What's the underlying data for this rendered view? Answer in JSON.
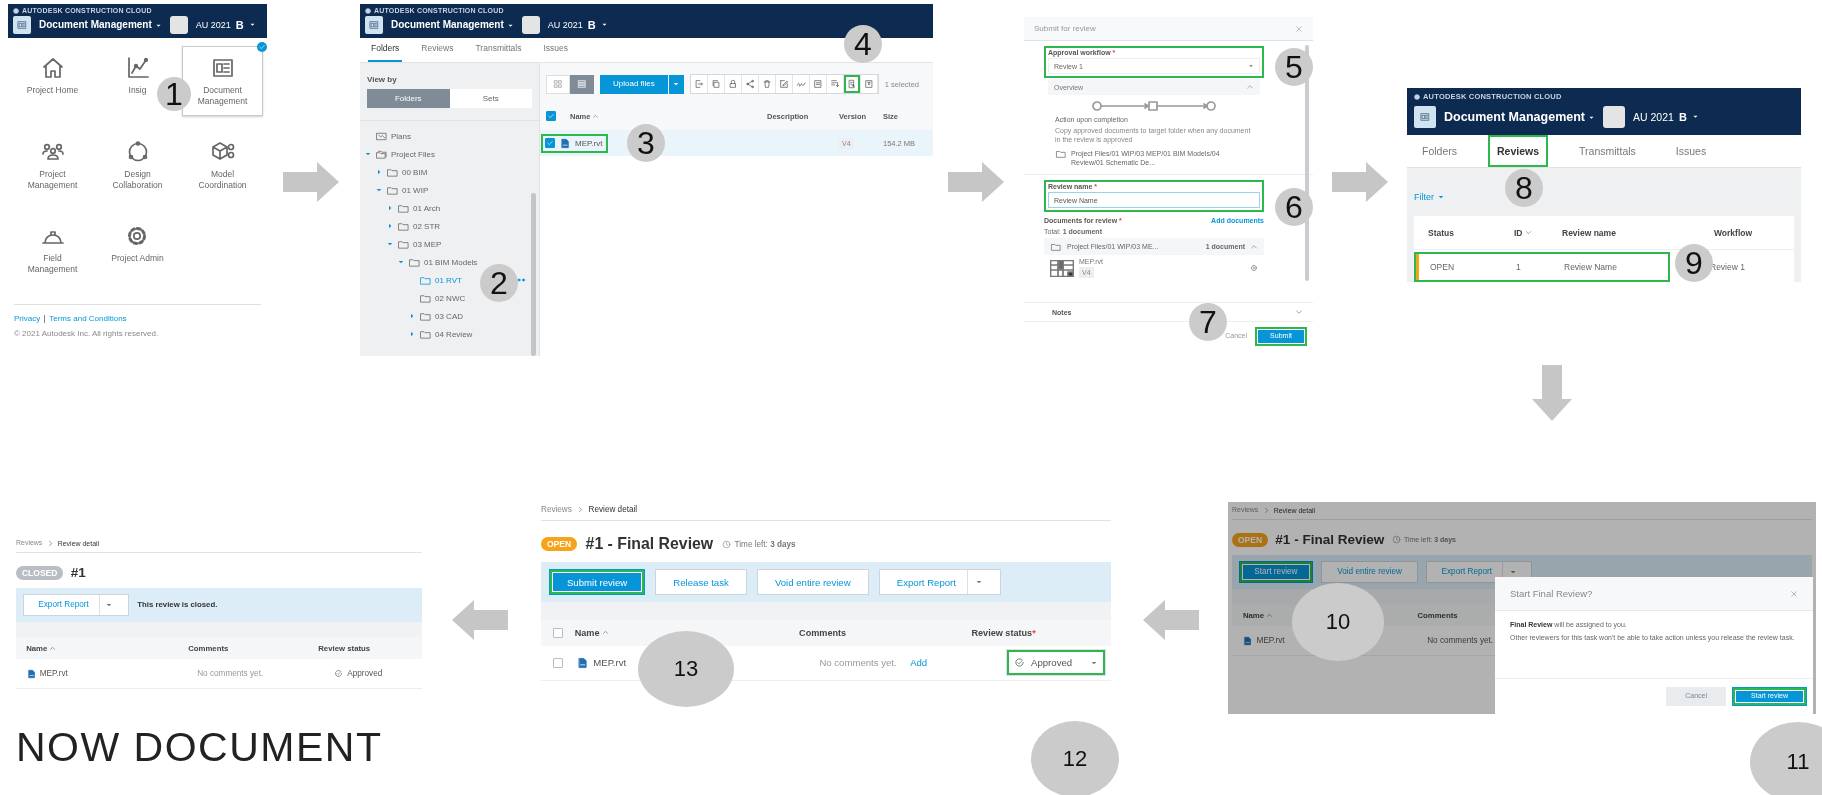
{
  "home_menu": {
    "header": {
      "brand": "AUTODESK CONSTRUCTION CLOUD",
      "module": "Document Management",
      "project": "AU 2021",
      "user": "B"
    },
    "tiles": [
      {
        "label": "Project Home",
        "kind": "home",
        "selected": false
      },
      {
        "label": "Insig",
        "kind": "chart",
        "selected": false
      },
      {
        "label": "Document Management",
        "kind": "docs",
        "selected": true
      },
      {
        "label": "Project Management",
        "kind": "people",
        "selected": false
      },
      {
        "label": "Design Collaboration",
        "kind": "circle",
        "selected": false
      },
      {
        "label": "Model Coordination",
        "kind": "cube",
        "selected": false
      },
      {
        "label": "Field Management",
        "kind": "helmet",
        "selected": false
      },
      {
        "label": "Project Admin",
        "kind": "gear",
        "selected": false
      }
    ],
    "links": [
      "Privacy",
      "Terms and Conditions"
    ],
    "copyright": "© 2021 Autodesk Inc. All rights reserved."
  },
  "files_view": {
    "header": {
      "brand": "AUTODESK CONSTRUCTION CLOUD",
      "module": "Document Management",
      "project": "AU 2021",
      "user": "B"
    },
    "tabs": [
      {
        "label": "Folders",
        "selected": true,
        "highlighted": false
      },
      {
        "label": "Reviews",
        "selected": false,
        "highlighted": false
      },
      {
        "label": "Transmittals",
        "selected": false,
        "highlighted": false
      },
      {
        "label": "Issues",
        "selected": false,
        "highlighted": false
      }
    ],
    "view_by": "View by",
    "view_toggle": [
      {
        "label": "Folders",
        "selected": true
      },
      {
        "label": "Sets",
        "selected": false
      }
    ],
    "tree": [
      {
        "label": "Plans",
        "kind": "plans",
        "selected": false
      },
      {
        "label": "Project Files",
        "kind": "project",
        "expanded": true,
        "selected": false,
        "children": [
          {
            "label": "00 BIM",
            "kind": "folder",
            "expanded": false,
            "selected": false
          },
          {
            "label": "01 WIP",
            "kind": "folder",
            "expanded": true,
            "selected": false,
            "children": [
              {
                "label": "01 Arch",
                "kind": "folder",
                "expanded": false,
                "selected": false
              },
              {
                "label": "02 STR",
                "kind": "folder",
                "expanded": false,
                "selected": false
              },
              {
                "label": "03 MEP",
                "kind": "folder",
                "expanded": true,
                "selected": false,
                "children": [
                  {
                    "label": "01 BIM Models",
                    "kind": "folder",
                    "expanded": true,
                    "selected": false,
                    "children": [
                      {
                        "label": "01 RVT",
                        "kind": "folder",
                        "selected": true
                      },
                      {
                        "label": "02 NWC",
                        "kind": "folder",
                        "selected": false
                      },
                      {
                        "label": "03 CAD",
                        "kind": "folder",
                        "expanded": false,
                        "selected": false
                      },
                      {
                        "label": "04 Review",
                        "kind": "folder",
                        "expanded": false,
                        "selected": false
                      }
                    ]
                  }
                ]
              }
            ]
          }
        ]
      }
    ],
    "layout_toggle": [
      {
        "kind": "grid",
        "selected": false
      },
      {
        "kind": "list",
        "selected": true
      }
    ],
    "upload_button": "Upload files",
    "tools": [
      {
        "kind": "export",
        "highlighted": false
      },
      {
        "kind": "copy",
        "highlighted": false
      },
      {
        "kind": "lock",
        "highlighted": false
      },
      {
        "kind": "share",
        "highlighted": false
      },
      {
        "kind": "delete",
        "highlighted": false
      },
      {
        "kind": "edit",
        "highlighted": false
      },
      {
        "kind": "sign",
        "highlighted": false
      },
      {
        "kind": "form",
        "highlighted": false
      },
      {
        "kind": "download",
        "highlighted": false
      },
      {
        "kind": "review",
        "highlighted": true
      },
      {
        "kind": "archive",
        "highlighted": false
      }
    ],
    "selection_count": "1 selected",
    "table": {
      "columns": [
        "Name",
        "Description",
        "Version",
        "Size"
      ],
      "all_checked": true,
      "rows": [
        {
          "checked": true,
          "selected": true,
          "highlighted": true,
          "name": "MEP.rvt",
          "version": "V4",
          "size": "154.2 MB"
        }
      ]
    }
  },
  "review_dialog": {
    "title": "Submit for review",
    "workflow": {
      "label": "Approval workflow",
      "required_mark": "*",
      "value": "Review 1",
      "highlighted": true
    },
    "overview": {
      "title": "Overview",
      "action_title": "Action upon completion",
      "action_text": "Copy approved documents to target folder when any document in the review is approved",
      "target_path": "Project Files/01 WIP/03 MEP/01 BIM Models/04 Review/01 Schematic De..."
    },
    "review_name": {
      "label": "Review name",
      "required_mark": "*",
      "value": "Review Name",
      "highlighted": true
    },
    "documents": {
      "label": "Documents for review",
      "required_mark": "*",
      "add_link": "Add documents",
      "total": "Total: **1 document**",
      "folder": "Project Files/01 WIP/03 ME...",
      "folder_count": "1 document",
      "files": [
        {
          "name": "MEP.rvt",
          "version": "V4"
        }
      ]
    },
    "notes": "Notes",
    "buttons": [
      {
        "label": "Cancel",
        "kind": "link",
        "highlighted": false
      },
      {
        "label": "Submit",
        "kind": "primary",
        "highlighted": true
      }
    ]
  },
  "reviews_list": {
    "header": {
      "brand": "AUTODESK CONSTRUCTION CLOUD",
      "module": "Document Management",
      "project": "AU 2021",
      "user": "B"
    },
    "tabs": [
      {
        "label": "Folders",
        "selected": false,
        "highlighted": false
      },
      {
        "label": "Reviews",
        "selected": true,
        "highlighted": true
      },
      {
        "label": "Transmittals",
        "selected": false,
        "highlighted": false
      },
      {
        "label": "Issues",
        "selected": false,
        "highlighted": false
      }
    ],
    "filter": "Filter",
    "columns": [
      "Status",
      "ID",
      "Review name",
      "Workflow"
    ],
    "rows": [
      {
        "status": "OPEN",
        "color": "#f5a31a",
        "id": "1",
        "name": "Review Name",
        "workflow": "Review 1",
        "highlighted": true
      }
    ]
  },
  "start_review_screen": {
    "dimmed": true,
    "breadcrumb": [
      "Reviews",
      "Review detail"
    ],
    "status": "OPEN",
    "closed": false,
    "title": "#1 - Final Review",
    "time_left": "Time left: **3 days**",
    "actions": [
      {
        "label": "Start review",
        "kind": "primary",
        "highlighted": true
      },
      {
        "label": "Void entire review",
        "kind": "secondary",
        "highlighted": false
      },
      {
        "label": "Export Report",
        "kind": "dropdown",
        "highlighted": false
      }
    ],
    "columns": [
      "Name",
      "Comments"
    ],
    "rows": [
      {
        "name": "MEP.rvt",
        "comment": "No comments yet."
      }
    ],
    "modal": {
      "title": "Start Final Review?",
      "message": "**Final Review** will be assigned to you.",
      "note": "Other reviewers for this task won't be able to take action unless you release the review task.",
      "buttons": [
        {
          "label": "Cancel",
          "kind": "disabled",
          "highlighted": false
        },
        {
          "label": "Start review",
          "kind": "primary",
          "highlighted": true
        }
      ]
    }
  },
  "submit_review_screen": {
    "breadcrumb": [
      "Reviews",
      "Review detail"
    ],
    "status": "OPEN",
    "closed": false,
    "title": "#1 - Final Review",
    "time_left": "Time left: **3 days**",
    "actions": [
      {
        "label": "Submit review",
        "kind": "primary",
        "highlighted": true
      },
      {
        "label": "Release task",
        "kind": "secondary",
        "highlighted": false
      },
      {
        "label": "Void entire review",
        "kind": "secondary",
        "highlighted": false
      },
      {
        "label": "Export Report",
        "kind": "dropdown",
        "highlighted": false
      }
    ],
    "columns": [
      "Name",
      "Comments",
      "Review status"
    ],
    "status_required_mark": "*",
    "all_checked": false,
    "rows": [
      {
        "checked": false,
        "name": "MEP.rvt",
        "comment": "No comments yet.",
        "comment_link": "Add",
        "status": "Approved",
        "status_highlighted": true
      }
    ]
  },
  "closed_review_screen": {
    "breadcrumb": [
      "Reviews",
      "Review detail"
    ],
    "status": "CLOSED",
    "closed": true,
    "title": "#1",
    "export_button": "Export Report",
    "message": "This review is closed.",
    "columns": [
      "Name",
      "Comments",
      "Review status"
    ],
    "rows": [
      {
        "name": "MEP.rvt",
        "comment": "No comments yet.",
        "status": "Approved"
      }
    ]
  },
  "caption": [
    "NOW DOCUMENT"
  ],
  "step_badges": [
    "1",
    "2",
    "3",
    "4",
    "5",
    "6",
    "7",
    "8",
    "9",
    "10",
    "11",
    "12",
    "13"
  ]
}
